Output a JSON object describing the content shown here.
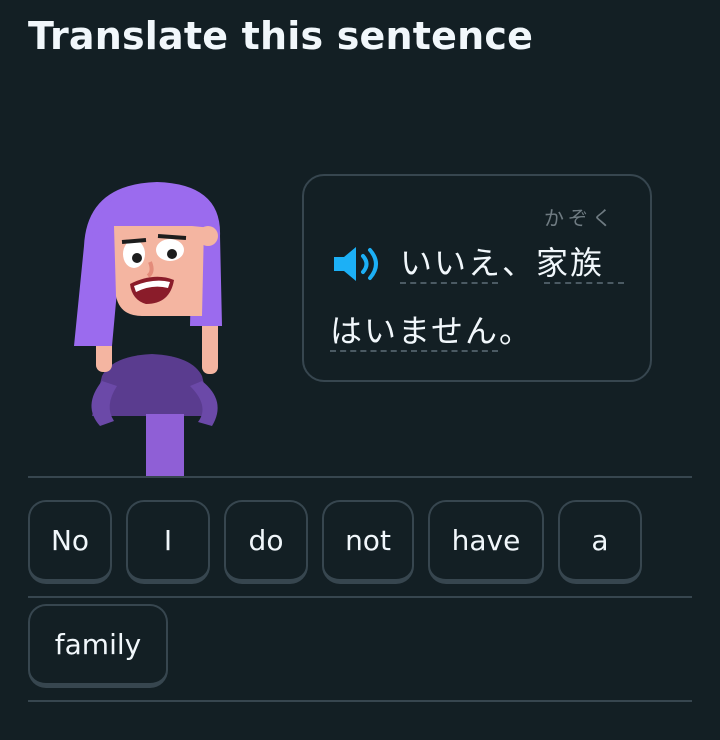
{
  "header": {
    "title": "Translate this sentence"
  },
  "prompt": {
    "furigana": "かぞく",
    "line1": "いいえ、家族",
    "line2": "はいません。",
    "speaker_icon": "speaker-icon",
    "accent_color": "#1cb0f6"
  },
  "word_bank": {
    "chips": [
      "No",
      "I",
      "do",
      "not",
      "have",
      "a",
      "family"
    ]
  }
}
